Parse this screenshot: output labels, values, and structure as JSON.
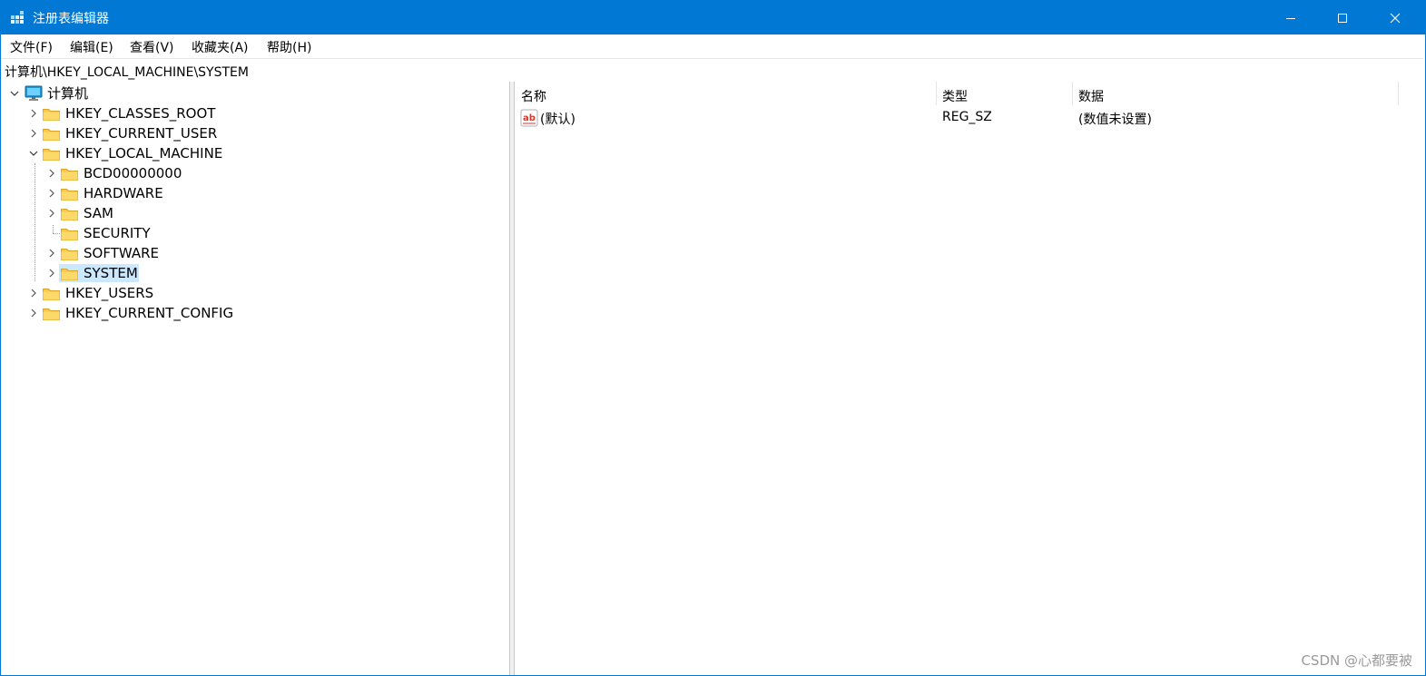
{
  "window": {
    "title": "注册表编辑器",
    "controls": {
      "minimize": "minimize",
      "maximize": "maximize",
      "close": "close"
    }
  },
  "menu": [
    {
      "label": "文件(F)"
    },
    {
      "label": "编辑(E)"
    },
    {
      "label": "查看(V)"
    },
    {
      "label": "收藏夹(A)"
    },
    {
      "label": "帮助(H)"
    }
  ],
  "address": "计算机\\HKEY_LOCAL_MACHINE\\SYSTEM",
  "tree": {
    "root": "计算机",
    "hkcr": "HKEY_CLASSES_ROOT",
    "hkcu": "HKEY_CURRENT_USER",
    "hklm": "HKEY_LOCAL_MACHINE",
    "hklm_children": [
      "BCD00000000",
      "HARDWARE",
      "SAM",
      "SECURITY",
      "SOFTWARE",
      "SYSTEM"
    ],
    "hku": "HKEY_USERS",
    "hkcc": "HKEY_CURRENT_CONFIG",
    "selected": "SYSTEM"
  },
  "list": {
    "columns": [
      "名称",
      "类型",
      "数据"
    ],
    "rows": [
      {
        "name": "(默认)",
        "type": "REG_SZ",
        "data": "(数值未设置)",
        "icon": "string-value-icon"
      }
    ]
  },
  "watermark": "CSDN @心都要被",
  "colors": {
    "titlebar": "#0078d4",
    "selection": "#cce8ff",
    "folder": "#f8c94a"
  }
}
